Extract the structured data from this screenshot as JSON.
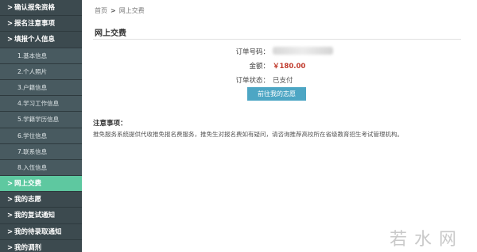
{
  "sidebar": {
    "items": [
      {
        "label": "确认报免资格",
        "type": "main",
        "chevron": ">"
      },
      {
        "label": "报名注意事项",
        "type": "main",
        "chevron": ">"
      },
      {
        "label": "填报个人信息",
        "type": "main",
        "chevron": ">"
      },
      {
        "label": "1.基本信息",
        "type": "sub"
      },
      {
        "label": "2.个人照片",
        "type": "sub"
      },
      {
        "label": "3.户籍信息",
        "type": "sub"
      },
      {
        "label": "4.学习工作信息",
        "type": "sub"
      },
      {
        "label": "5.学籍学历信息",
        "type": "sub"
      },
      {
        "label": "6.学位信息",
        "type": "sub"
      },
      {
        "label": "7.联系信息",
        "type": "sub"
      },
      {
        "label": "8.入伍信息",
        "type": "sub"
      },
      {
        "label": "网上交费",
        "type": "main",
        "chevron": ">",
        "active": true
      },
      {
        "label": "我的志愿",
        "type": "main",
        "chevron": ">"
      },
      {
        "label": "我的复试通知",
        "type": "main",
        "chevron": ">"
      },
      {
        "label": "我的待录取通知",
        "type": "main",
        "chevron": ">"
      },
      {
        "label": "我的调剂",
        "type": "main",
        "chevron": ">"
      }
    ],
    "active_color": "#5ec8a0"
  },
  "breadcrumb": {
    "home": "首页",
    "separator": ">",
    "current": "网上交费"
  },
  "page_title": "网上交费",
  "order": {
    "order_no_label": "订单号码：",
    "amount_label": "金额：",
    "amount_value": "￥180.00",
    "status_label": "订单状态：",
    "status_value": "已支付"
  },
  "view_button_label": "前往我的志愿",
  "notice": {
    "title": "注意事项：",
    "text": "推免服务系统提供代收推免报名费服务，推免生对报名费如有疑问，请咨询推荐高校所在省级教育招生考试管理机构。"
  },
  "watermark": "若水网",
  "colors": {
    "sidebar_bg": "#3c4a4f",
    "button": "#4da6c4",
    "amount": "#c0392b"
  }
}
